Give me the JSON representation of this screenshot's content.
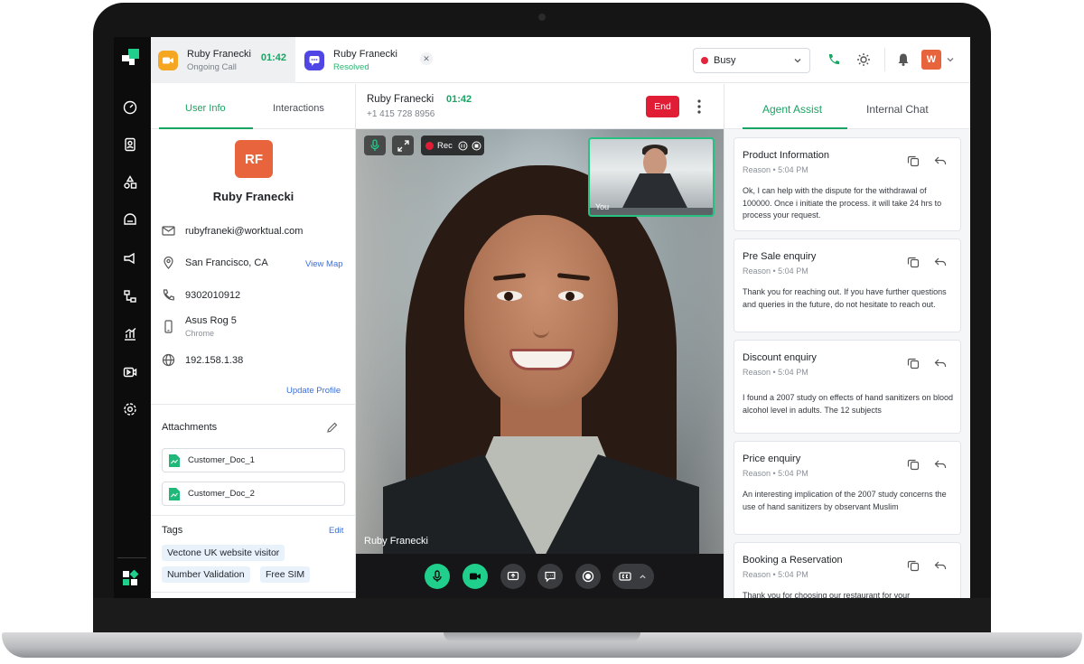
{
  "tabs": [
    {
      "name": "Ruby Franecki",
      "sub": "Ongoing Call",
      "timer": "01:42",
      "icon": "video-camera-icon",
      "icon_color": "#f5a623"
    },
    {
      "name": "Ruby Franecki",
      "sub": "Resolved",
      "icon": "chat-icon",
      "icon_color": "#4f46e5",
      "close": "✕"
    }
  ],
  "status": {
    "value": "Busy",
    "dot_color": "#e0263a"
  },
  "user_menu": {
    "initial": "W",
    "color": "#e8643c"
  },
  "left_panel": {
    "tabs": [
      "User Info",
      "Interactions"
    ],
    "avatar_initials": "RF",
    "name": "Ruby Franecki",
    "email": "rubyfraneki@worktual.com",
    "location": "San Francisco, CA",
    "view_map": "View Map",
    "phone": "9302010912",
    "device": "Asus Rog 5",
    "browser": "Chrome",
    "ip": "192.158.1.38",
    "update_profile": "Update Profile",
    "attachments_title": "Attachments",
    "attachments": [
      "Customer_Doc_1",
      "Customer_Doc_2"
    ],
    "tags_title": "Tags",
    "tags_edit": "Edit",
    "tags": [
      "Vectone UK website visitor",
      "Number Validation",
      "Free SIM"
    ]
  },
  "call": {
    "name": "Ruby Franecki",
    "timer": "01:42",
    "phone": "+1 415 728 8956",
    "end_label": "End",
    "rec_label": "Rec",
    "caller_label": "Ruby Franecki",
    "self_label": "You"
  },
  "right_panel": {
    "tabs": [
      "Agent Assist",
      "Internal Chat"
    ],
    "cards": [
      {
        "title": "Product Information",
        "reason": "Reason  •  5:04 PM",
        "body": "Ok, I can help with the dispute for the withdrawal of 100000. Once i initiate the process. it will take 24 hrs  to process your request."
      },
      {
        "title": "Pre Sale enquiry",
        "reason": "Reason  •  5:04 PM",
        "body": "Thank you for reaching out. If you have further questions and queries in the future, do not hesitate to reach out."
      },
      {
        "title": "Discount enquiry",
        "reason": "Reason  •  5:04 PM",
        "body": "I found a 2007 study on effects of hand sanitizers on blood alcohol level in adults. The 12 subjects"
      },
      {
        "title": "Price enquiry",
        "reason": "Reason  •  5:04 PM",
        "body": "An interesting implication of the 2007 study concerns the use of hand sanitizers by observant Muslim"
      },
      {
        "title": "Booking a Reservation",
        "reason": "Reason  •  5:04 PM",
        "body": "Thank you for choosing our restaurant for your"
      }
    ]
  },
  "colors": {
    "accent": "#19a463",
    "end": "#e11d36",
    "link": "#3b6fd6"
  }
}
